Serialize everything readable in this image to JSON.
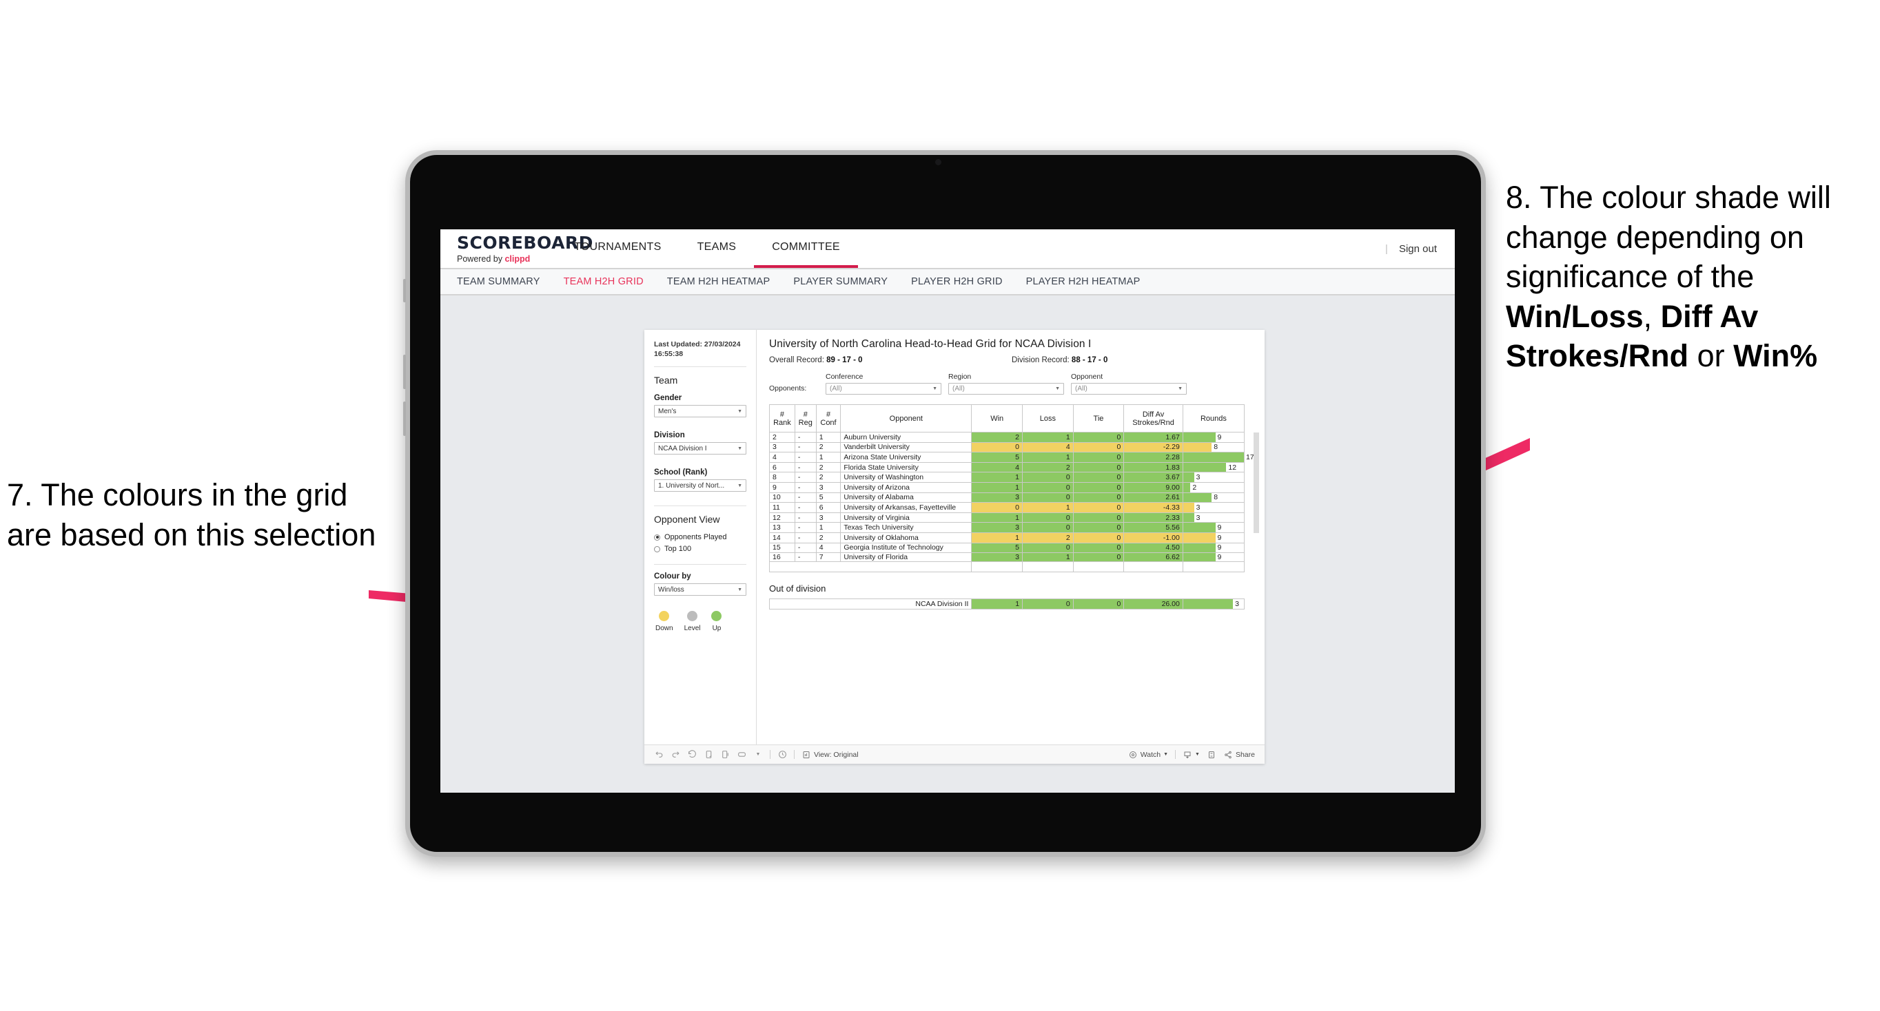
{
  "annotations": {
    "left": "7. The colours in the grid are based on this selection",
    "right_pre": "8. The colour shade will change depending on significance of the ",
    "right_b1": "Win/Loss",
    "right_mid1": ", ",
    "right_b2": "Diff Av Strokes/Rnd",
    "right_mid2": " or ",
    "right_b3": "Win%",
    "arrow_color": "#ee2a64"
  },
  "app": {
    "brand_title": "SCOREBOARD",
    "brand_sub_prefix": "Powered by ",
    "brand_sub_accent": "clippd",
    "sign_out": "Sign out",
    "divider": "|",
    "accent_pink": "#e8335a",
    "active_underline": "#d31c4b",
    "nav_tabs": [
      {
        "label": "TOURNAMENTS",
        "active": false
      },
      {
        "label": "TEAMS",
        "active": false
      },
      {
        "label": "COMMITTEE",
        "active": true
      }
    ],
    "sub_tabs": [
      {
        "label": "TEAM SUMMARY",
        "active": false
      },
      {
        "label": "TEAM H2H GRID",
        "active": true
      },
      {
        "label": "TEAM H2H HEATMAP",
        "active": false
      },
      {
        "label": "PLAYER SUMMARY",
        "active": false
      },
      {
        "label": "PLAYER H2H GRID",
        "active": false
      },
      {
        "label": "PLAYER H2H HEATMAP",
        "active": false
      }
    ]
  },
  "sidebar": {
    "last_updated": "Last Updated: 27/03/2024 16:55:38",
    "team_heading": "Team",
    "gender_label": "Gender",
    "gender_value": "Men's",
    "division_label": "Division",
    "division_value": "NCAA Division I",
    "school_label": "School (Rank)",
    "school_value": "1. University of Nort...",
    "opponent_view_heading": "Opponent View",
    "radio_opponents_played": "Opponents Played",
    "radio_top_100": "Top 100",
    "colour_by_label": "Colour by",
    "colour_by_value": "Win/loss",
    "legend": [
      {
        "label": "Down",
        "color": "#f3d35f"
      },
      {
        "label": "Level",
        "color": "#bcbcbc"
      },
      {
        "label": "Up",
        "color": "#8dc963"
      }
    ]
  },
  "viz": {
    "title": "University of North Carolina Head-to-Head Grid for NCAA Division I",
    "overall_record_label": "Overall Record: ",
    "overall_record_value": "89 - 17 - 0",
    "division_record_label": "Division Record: ",
    "division_record_value": "88 - 17 - 0",
    "opponents_label": "Opponents:",
    "filters": [
      {
        "label": "Conference",
        "value": "(All)"
      },
      {
        "label": "Region",
        "value": "(All)"
      },
      {
        "label": "Opponent",
        "value": "(All)"
      }
    ],
    "columns": [
      "# Rank",
      "# Reg",
      "# Conf",
      "Opponent",
      "Win",
      "Loss",
      "Tie",
      "Diff Av Strokes/Rnd",
      "Rounds"
    ],
    "col_rank_l1": "#",
    "col_rank_l2": "Rank",
    "col_reg_l1": "#",
    "col_reg_l2": "Reg",
    "col_conf_l1": "#",
    "col_conf_l2": "Conf",
    "col_opponent": "Opponent",
    "col_win": "Win",
    "col_loss": "Loss",
    "col_tie": "Tie",
    "col_diff_l1": "Diff Av",
    "col_diff_l2": "Strokes/Rnd",
    "col_rounds": "Rounds",
    "out_of_division_title": "Out of division",
    "out_of_division_row": {
      "label": "NCAA Division II",
      "win": "1",
      "loss": "0",
      "tie": "0",
      "diff": "26.00",
      "rounds": "3",
      "state": "up"
    }
  },
  "chart_data": {
    "type": "table",
    "title": "University of North Carolina Head-to-Head Grid for NCAA Division I",
    "columns": [
      "# Rank",
      "# Reg",
      "# Conf",
      "Opponent",
      "Win",
      "Loss",
      "Tie",
      "Diff Av Strokes/Rnd",
      "Rounds"
    ],
    "rows": [
      {
        "rank": "2",
        "reg": "-",
        "conf": "1",
        "opponent": "Auburn University",
        "win": "2",
        "loss": "1",
        "tie": "0",
        "diff": "1.67",
        "rounds": "9",
        "state": "up"
      },
      {
        "rank": "3",
        "reg": "-",
        "conf": "2",
        "opponent": "Vanderbilt University",
        "win": "0",
        "loss": "4",
        "tie": "0",
        "diff": "-2.29",
        "rounds": "8",
        "state": "down"
      },
      {
        "rank": "4",
        "reg": "-",
        "conf": "1",
        "opponent": "Arizona State University",
        "win": "5",
        "loss": "1",
        "tie": "0",
        "diff": "2.28",
        "rounds": "17",
        "state": "up"
      },
      {
        "rank": "6",
        "reg": "-",
        "conf": "2",
        "opponent": "Florida State University",
        "win": "4",
        "loss": "2",
        "tie": "0",
        "diff": "1.83",
        "rounds": "12",
        "state": "up"
      },
      {
        "rank": "8",
        "reg": "-",
        "conf": "2",
        "opponent": "University of Washington",
        "win": "1",
        "loss": "0",
        "tie": "0",
        "diff": "3.67",
        "rounds": "3",
        "state": "up"
      },
      {
        "rank": "9",
        "reg": "-",
        "conf": "3",
        "opponent": "University of Arizona",
        "win": "1",
        "loss": "0",
        "tie": "0",
        "diff": "9.00",
        "rounds": "2",
        "state": "up"
      },
      {
        "rank": "10",
        "reg": "-",
        "conf": "5",
        "opponent": "University of Alabama",
        "win": "3",
        "loss": "0",
        "tie": "0",
        "diff": "2.61",
        "rounds": "8",
        "state": "up"
      },
      {
        "rank": "11",
        "reg": "-",
        "conf": "6",
        "opponent": "University of Arkansas, Fayetteville",
        "win": "0",
        "loss": "1",
        "tie": "0",
        "diff": "-4.33",
        "rounds": "3",
        "state": "down"
      },
      {
        "rank": "12",
        "reg": "-",
        "conf": "3",
        "opponent": "University of Virginia",
        "win": "1",
        "loss": "0",
        "tie": "0",
        "diff": "2.33",
        "rounds": "3",
        "state": "up"
      },
      {
        "rank": "13",
        "reg": "-",
        "conf": "1",
        "opponent": "Texas Tech University",
        "win": "3",
        "loss": "0",
        "tie": "0",
        "diff": "5.56",
        "rounds": "9",
        "state": "up"
      },
      {
        "rank": "14",
        "reg": "-",
        "conf": "2",
        "opponent": "University of Oklahoma",
        "win": "1",
        "loss": "2",
        "tie": "0",
        "diff": "-1.00",
        "rounds": "9",
        "state": "down"
      },
      {
        "rank": "15",
        "reg": "-",
        "conf": "4",
        "opponent": "Georgia Institute of Technology",
        "win": "5",
        "loss": "0",
        "tie": "0",
        "diff": "4.50",
        "rounds": "9",
        "state": "up"
      },
      {
        "rank": "16",
        "reg": "-",
        "conf": "7",
        "opponent": "University of Florida",
        "win": "3",
        "loss": "1",
        "tie": "0",
        "diff": "6.62",
        "rounds": "9",
        "state": "up"
      }
    ],
    "rounds_max": 17,
    "colors": {
      "up": "#8dc963",
      "down": "#f2d262",
      "level": "#bcbcbc"
    }
  },
  "toolbar": {
    "view_label": "View: Original",
    "watch_label": "Watch",
    "share_label": "Share",
    "caret": "▾",
    "divider": "|"
  }
}
